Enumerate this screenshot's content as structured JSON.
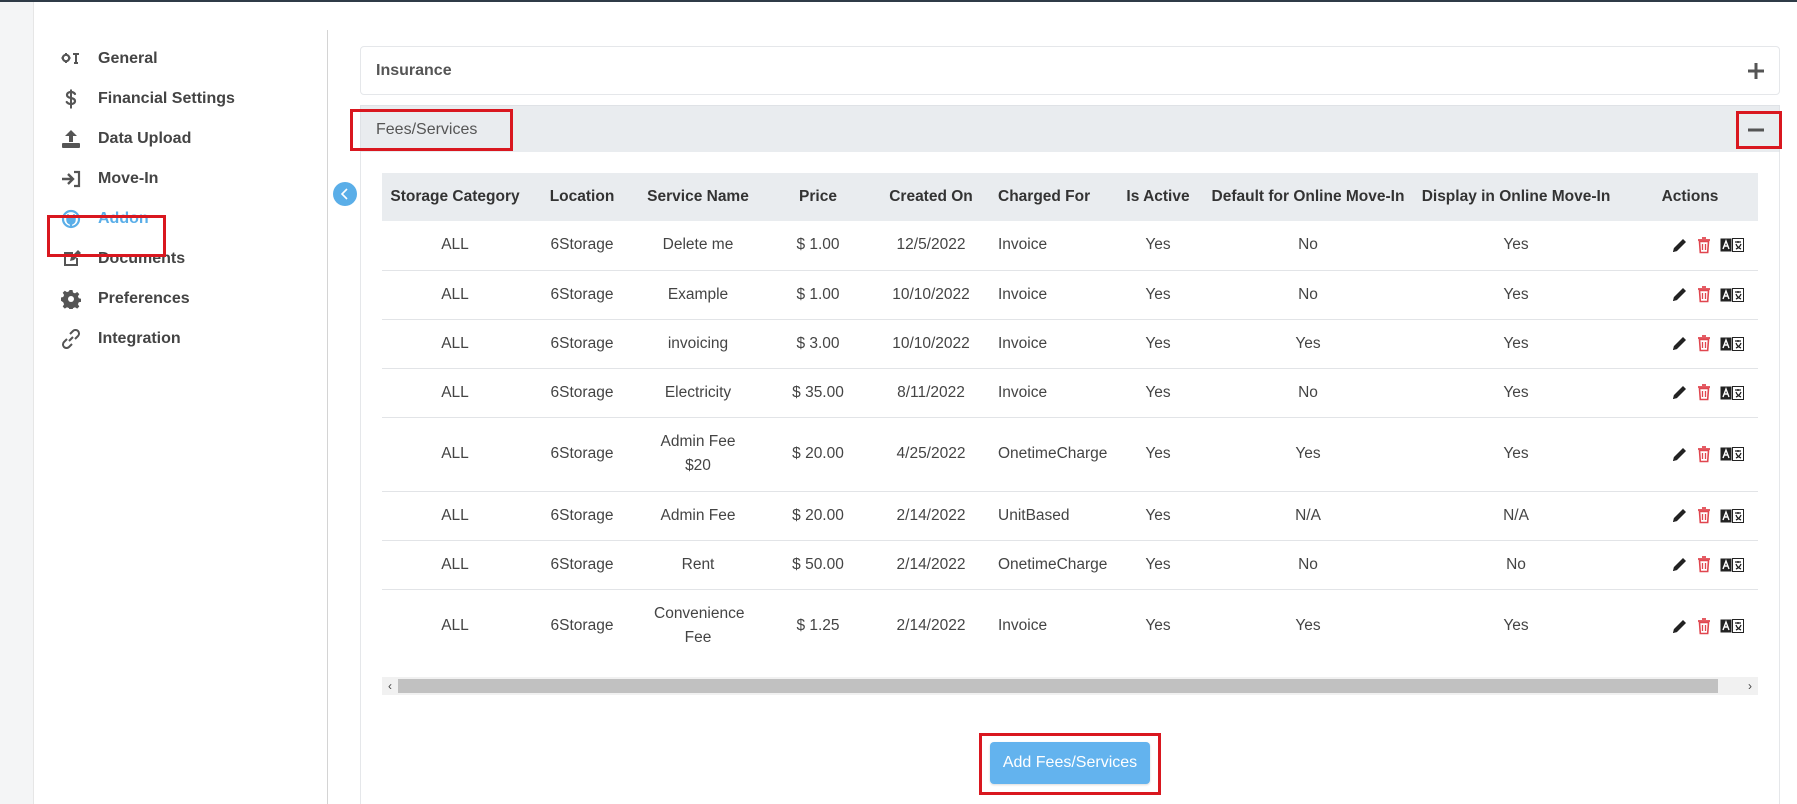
{
  "sidebar": {
    "items": [
      {
        "label": "General",
        "icon": "wrench-screwdriver-icon"
      },
      {
        "label": "Financial Settings",
        "icon": "dollar-icon"
      },
      {
        "label": "Data Upload",
        "icon": "upload-icon"
      },
      {
        "label": "Move-In",
        "icon": "sign-in-icon"
      },
      {
        "label": "Addon",
        "icon": "plug-icon",
        "active": true
      },
      {
        "label": "Documents",
        "icon": "edit-document-icon"
      },
      {
        "label": "Preferences",
        "icon": "gear-icon"
      },
      {
        "label": "Integration",
        "icon": "link-icon"
      }
    ]
  },
  "panels": {
    "insurance": {
      "title": "Insurance",
      "toggle": "+"
    },
    "fees": {
      "title": "Fees/Services",
      "toggle": "−"
    }
  },
  "table": {
    "columns": [
      "Storage Category",
      "Location",
      "Service Name",
      "Price",
      "Created On",
      "Charged For",
      "Is Active",
      "Default for Online Move-In",
      "Display in Online Move-In",
      "Actions"
    ],
    "rows": [
      {
        "category": "ALL",
        "location": "6Storage",
        "service": "Delete me",
        "price": "$ 1.00",
        "created": "12/5/2022",
        "charged": "Invoice",
        "active": "Yes",
        "default_online": "No",
        "display_online": "Yes"
      },
      {
        "category": "ALL",
        "location": "6Storage",
        "service": "Example",
        "price": "$ 1.00",
        "created": "10/10/2022",
        "charged": "Invoice",
        "active": "Yes",
        "default_online": "No",
        "display_online": "Yes"
      },
      {
        "category": "ALL",
        "location": "6Storage",
        "service": "invoicing",
        "price": "$ 3.00",
        "created": "10/10/2022",
        "charged": "Invoice",
        "active": "Yes",
        "default_online": "Yes",
        "display_online": "Yes"
      },
      {
        "category": "ALL",
        "location": "6Storage",
        "service": "Electricity",
        "price": "$ 35.00",
        "created": "8/11/2022",
        "charged": "Invoice",
        "active": "Yes",
        "default_online": "No",
        "display_online": "Yes"
      },
      {
        "category": "ALL",
        "location": "6Storage",
        "service": "Admin Fee $20",
        "price": "$ 20.00",
        "created": "4/25/2022",
        "charged": "OnetimeCharge",
        "active": "Yes",
        "default_online": "Yes",
        "display_online": "Yes"
      },
      {
        "category": "ALL",
        "location": "6Storage",
        "service": "Admin Fee",
        "price": "$ 20.00",
        "created": "2/14/2022",
        "charged": "UnitBased",
        "active": "Yes",
        "default_online": "N/A",
        "display_online": "N/A"
      },
      {
        "category": "ALL",
        "location": "6Storage",
        "service": "Rent",
        "price": "$ 50.00",
        "created": "2/14/2022",
        "charged": "OnetimeCharge",
        "active": "Yes",
        "default_online": "No",
        "display_online": "No"
      },
      {
        "category": "ALL",
        "location": "6Storage",
        "service": "Convenience Fee",
        "price": "$ 1.25",
        "created": "2/14/2022",
        "charged": "Invoice",
        "active": "Yes",
        "default_online": "Yes",
        "display_online": "Yes"
      }
    ]
  },
  "buttons": {
    "add_fees": "Add Fees/Services"
  },
  "colors": {
    "accent": "#5aaee8",
    "highlight": "#d9171f",
    "delete": "#e0464f"
  }
}
